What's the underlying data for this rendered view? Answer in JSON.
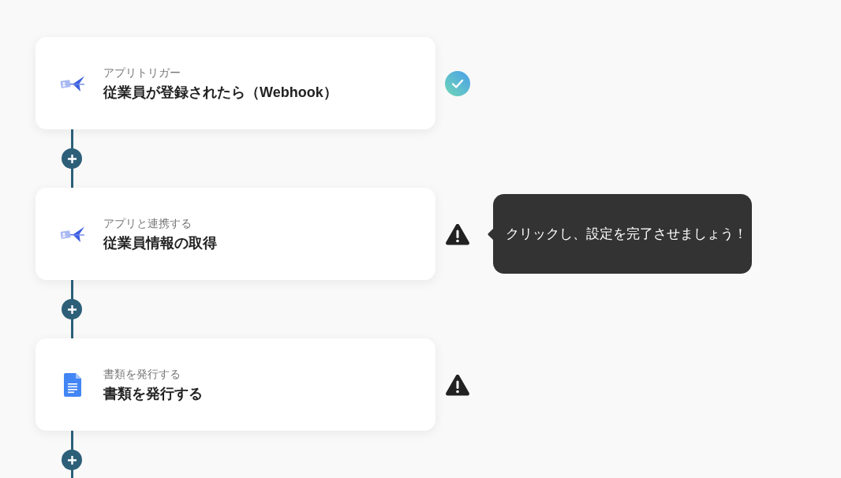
{
  "steps": [
    {
      "kind": "app",
      "label": "アプリトリガー",
      "title": "従業員が登録されたら（Webhook）",
      "done": true
    },
    {
      "kind": "app",
      "label": "アプリと連携する",
      "title": "従業員情報の取得",
      "done": false,
      "tooltip": "クリックし、設定を完了させましょう！"
    },
    {
      "kind": "document",
      "label": "書類を発行する",
      "title": "書類を発行する",
      "done": false
    }
  ]
}
